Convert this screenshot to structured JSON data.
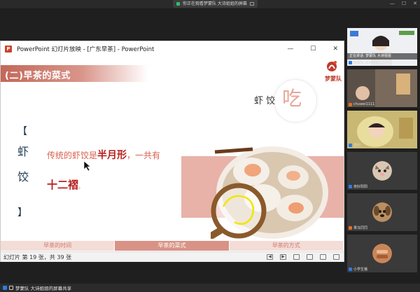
{
  "meeting": {
    "share_notice": "你正在观看梦蒙队 大诗姐姐的屏幕",
    "bottom_label": "梦蒙队 大诗姐姐的屏幕共享"
  },
  "window": {
    "title": "PowerPoint 幻灯片放映 - [广东早茶] - PowerPoint",
    "logo": "P",
    "minimize": "—",
    "maximize": "☐",
    "close": "✕"
  },
  "slide": {
    "section_title": "(二)早茶的菜式",
    "brand_name": "梦蒙队",
    "big_char": "吃",
    "dish_name": "虾饺",
    "bracket_open": "【",
    "bracket_close": "】",
    "vertical_chars": [
      "虾",
      "饺"
    ],
    "desc_prefix": "传统的虾饺是",
    "desc_bold": "半月形",
    "desc_suffix": "，一共有",
    "desc_count": "十二褶",
    "desc_end": "。"
  },
  "slide_nav": [
    "早茶的时间",
    "早茶的菜式",
    "早茶的方式"
  ],
  "status": {
    "text": "幻灯片 第 19 张，共 39 张"
  },
  "participants": [
    {
      "name": "梦蒙队 大诗姐姐",
      "speaking": "正在讲话: 梦蒙队 大诗姐姐",
      "muted": false
    },
    {
      "name": "chuwei1111",
      "muted": true
    },
    {
      "name": "里约",
      "muted": false
    },
    {
      "name": "夜好阳阳",
      "muted": false
    },
    {
      "name": "果冻同同",
      "muted": true
    },
    {
      "name": "小学生猪",
      "muted": false
    }
  ],
  "colors": {
    "accent": "#d89386",
    "text_red": "#b81f1f",
    "nav_bg": "#f4dcd7"
  }
}
